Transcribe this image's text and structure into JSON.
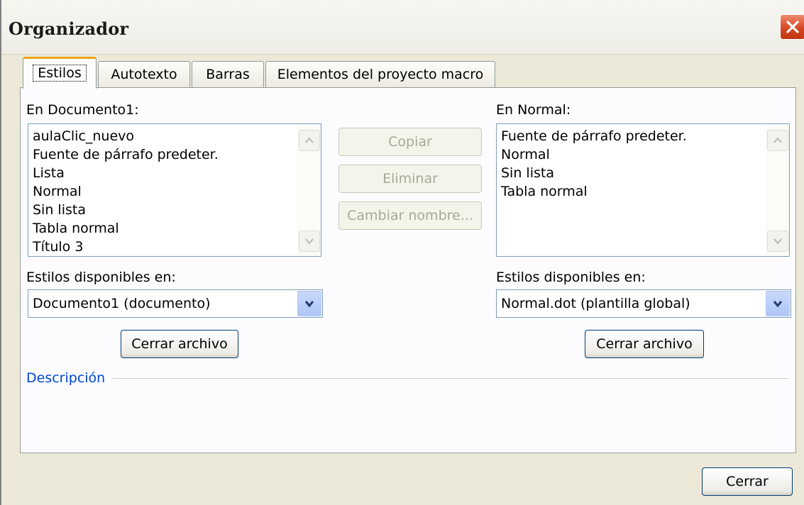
{
  "window": {
    "title": "Organizador"
  },
  "tabs": [
    {
      "label": "Estilos",
      "active": true
    },
    {
      "label": "Autotexto",
      "active": false
    },
    {
      "label": "Barras",
      "active": false
    },
    {
      "label": "Elementos del proyecto macro",
      "active": false
    }
  ],
  "left": {
    "list_label": "En Documento1:",
    "items": [
      "aulaClic_nuevo",
      "Fuente de párrafo predeter.",
      "Lista",
      "Normal",
      "Sin lista",
      "Tabla normal",
      "Título 3"
    ],
    "available_label": "Estilos disponibles en:",
    "available_value": "Documento1 (documento)",
    "close_file_label": "Cerrar archivo"
  },
  "middle": {
    "copy_label": "Copiar",
    "delete_label": "Eliminar",
    "rename_label": "Cambiar nombre..."
  },
  "right": {
    "list_label": "En Normal:",
    "items": [
      "Fuente de párrafo predeter.",
      "Normal",
      "Sin lista",
      "Tabla normal"
    ],
    "available_label": "Estilos disponibles en:",
    "available_value": "Normal.dot (plantilla global)",
    "close_file_label": "Cerrar archivo"
  },
  "description": {
    "label": "Descripción"
  },
  "footer": {
    "close_label": "Cerrar"
  },
  "colors": {
    "accent": "#0046d5",
    "tab_highlight": "#f2a418",
    "close_red": "#d4431e"
  }
}
